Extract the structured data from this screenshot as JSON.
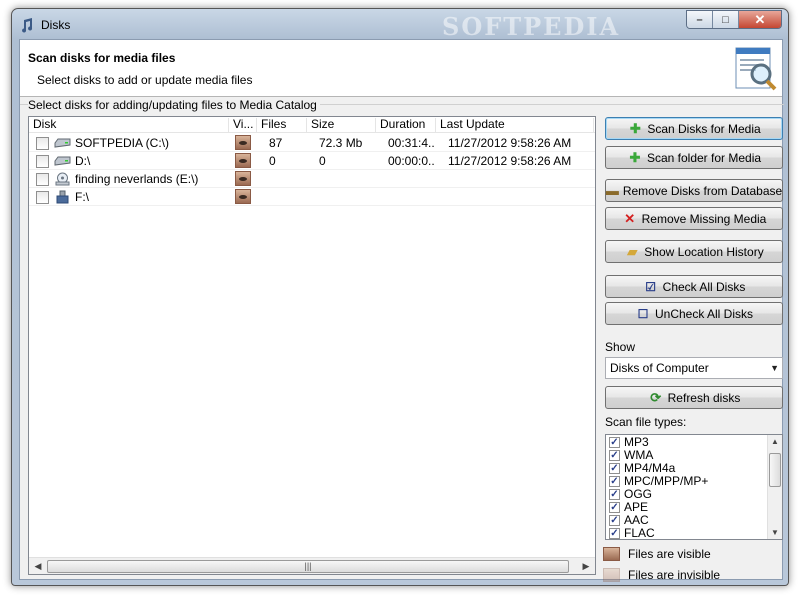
{
  "window": {
    "title": "Disks",
    "watermark": "SOFTPEDIA"
  },
  "header": {
    "title": "Scan disks for media files",
    "subtitle": "Select disks to add or update media files"
  },
  "group_label": "Select disks for adding/updating files to Media Catalog",
  "columns": [
    "Disk",
    "Vi...",
    "Files",
    "Size",
    "Duration",
    "Last Update"
  ],
  "disks": [
    {
      "name": "SOFTPEDIA (C:\\)",
      "files": "87",
      "size": "72.3 Mb",
      "duration": "00:31:4...",
      "last_update": "11/27/2012 9:58:26 AM",
      "icon": "hard-drive-icon"
    },
    {
      "name": "D:\\",
      "files": "0",
      "size": "0",
      "duration": "00:00:0...",
      "last_update": "11/27/2012 9:58:26 AM",
      "icon": "hard-drive-icon"
    },
    {
      "name": "finding neverlands (E:\\)",
      "files": "",
      "size": "",
      "duration": "",
      "last_update": "",
      "icon": "cd-drive-icon"
    },
    {
      "name": "F:\\",
      "files": "",
      "size": "",
      "duration": "",
      "last_update": "",
      "icon": "usb-drive-icon"
    }
  ],
  "buttons": {
    "scan_disks": "Scan Disks for Media",
    "scan_folder": "Scan folder for Media",
    "remove_disks": "Remove Disks from Database",
    "remove_missing": "Remove Missing Media",
    "show_history": "Show Location History",
    "check_all": "Check All Disks",
    "uncheck_all": "UnCheck All Disks",
    "refresh": "Refresh disks"
  },
  "show": {
    "label": "Show",
    "value": "Disks of Computer"
  },
  "file_types": {
    "label": "Scan file types:",
    "items": [
      "MP3",
      "WMA",
      "MP4/M4a",
      "MPC/MPP/MP+",
      "OGG",
      "APE",
      "AAC",
      "FLAC"
    ]
  },
  "legend": {
    "visible": "Files are visible",
    "invisible": "Files are invisible"
  },
  "colors": {
    "title_bar": "#b9c8da",
    "client_bg": "#f0f0f0",
    "remove_icon": "#d42020",
    "add_icon": "#3aa83a"
  }
}
